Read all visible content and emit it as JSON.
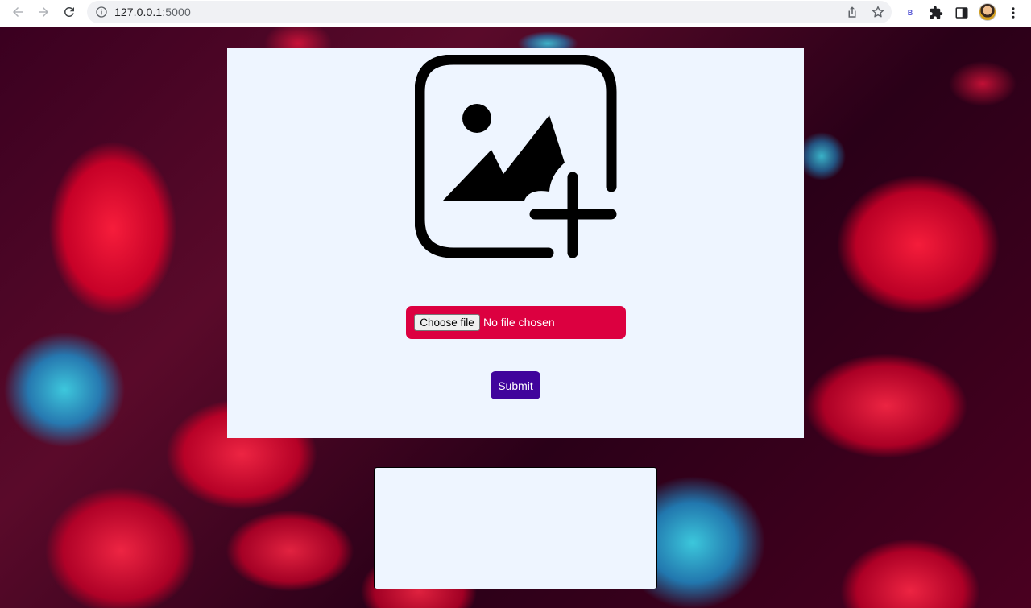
{
  "browser": {
    "url_host": "127.0.0.1",
    "url_port": ":5000",
    "icons": [
      "back-arrow-icon",
      "forward-arrow-icon",
      "reload-icon",
      "info-icon",
      "share-icon",
      "star-icon",
      "extension-b-icon",
      "puzzle-icon",
      "side-panel-icon",
      "avatar",
      "kebab-menu-icon"
    ],
    "extension_letter": "B"
  },
  "upload": {
    "icon": "add-image-icon",
    "choose_file_label": "Choose file",
    "no_file_text": "No file chosen",
    "submit_label": "Submit",
    "colors": {
      "card_bg": "#eef5ff",
      "file_input_bg": "#dc0040",
      "submit_bg": "#40049c"
    }
  },
  "result": {
    "text": ""
  }
}
